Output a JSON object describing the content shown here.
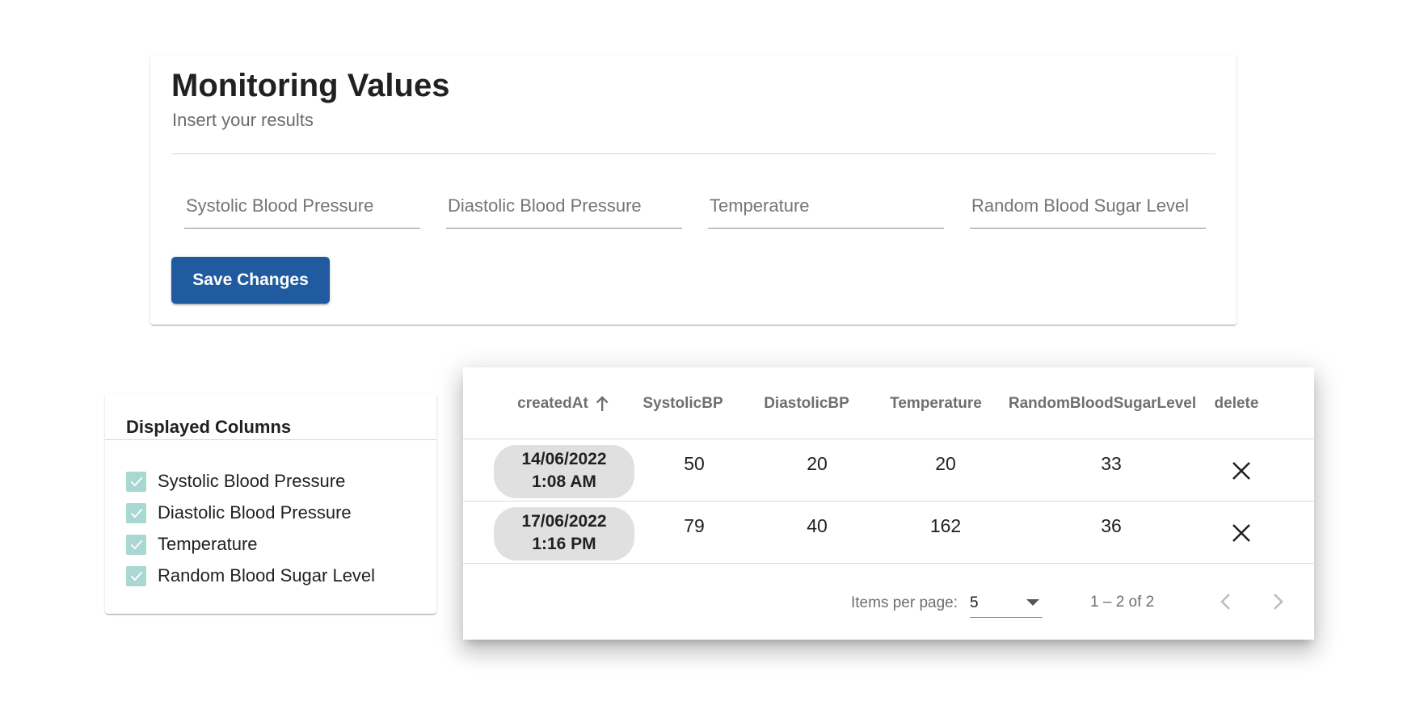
{
  "form": {
    "title": "Monitoring Values",
    "subtitle": "Insert your results",
    "fields": [
      {
        "placeholder": "Systolic Blood Pressure",
        "value": ""
      },
      {
        "placeholder": "Diastolic Blood Pressure",
        "value": ""
      },
      {
        "placeholder": "Temperature",
        "value": ""
      },
      {
        "placeholder": "Random Blood Sugar Level",
        "value": ""
      }
    ],
    "save_label": "Save Changes"
  },
  "columns_panel": {
    "title": "Displayed Columns",
    "items": [
      {
        "label": "Systolic Blood Pressure",
        "checked": true
      },
      {
        "label": "Diastolic Blood Pressure",
        "checked": true
      },
      {
        "label": "Temperature",
        "checked": true
      },
      {
        "label": "Random Blood Sugar Level",
        "checked": true
      }
    ],
    "checkbox_color": "#a9d7d2"
  },
  "table": {
    "headers": [
      "createdAt",
      "SystolicBP",
      "DiastolicBP",
      "Temperature",
      "RandomBloodSugarLevel",
      "delete"
    ],
    "sort": {
      "column": "createdAt",
      "direction": "asc"
    },
    "rows": [
      {
        "date": "14/06/2022",
        "time": "1:08 AM",
        "systolic": "50",
        "diastolic": "20",
        "temperature": "20",
        "sugar": "33"
      },
      {
        "date": "17/06/2022",
        "time": "1:16 PM",
        "systolic": "79",
        "diastolic": "40",
        "temperature": "162",
        "sugar": "36"
      }
    ],
    "paginator": {
      "items_per_page_label": "Items per page:",
      "items_per_page": "5",
      "range": "1 – 2 of 2"
    }
  },
  "colors": {
    "primary": "#1f5b9e",
    "chip": "#e0e0e0"
  }
}
